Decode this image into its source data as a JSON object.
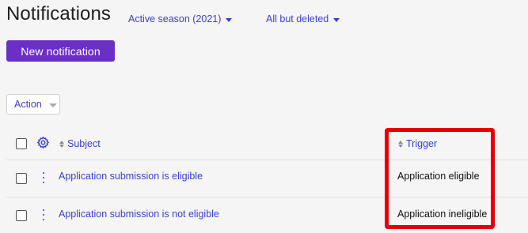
{
  "header": {
    "title": "Notifications",
    "season_filter": "Active season (2021)",
    "status_filter": "All but deleted"
  },
  "toolbar": {
    "new_button": "New notification",
    "action_label": "Action"
  },
  "table": {
    "columns": {
      "subject": "Subject",
      "trigger": "Trigger"
    },
    "rows": [
      {
        "subject": "Application submission is eligible",
        "trigger": "Application eligible"
      },
      {
        "subject": "Application submission is not eligible",
        "trigger": "Application ineligible"
      }
    ]
  },
  "colors": {
    "accent": "#3a3fd6",
    "primary_button": "#6a2fc4",
    "highlight": "#e50000"
  }
}
